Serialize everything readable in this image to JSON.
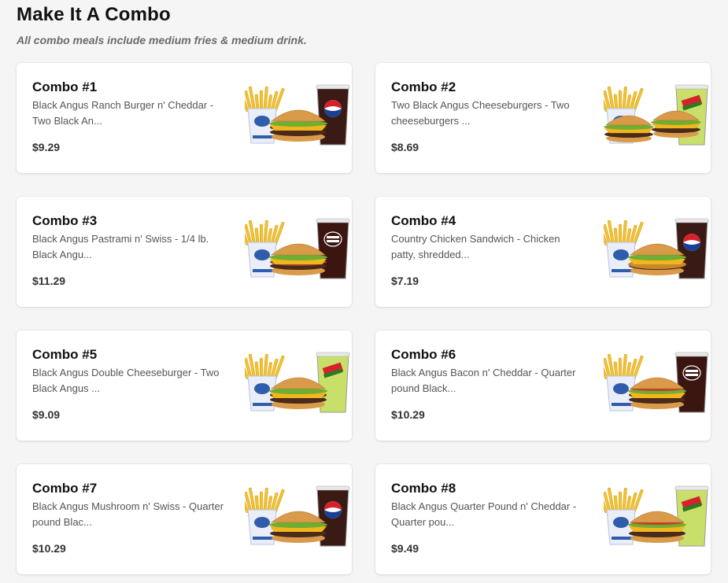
{
  "section": {
    "title": "Make It A Combo",
    "subtitle": "All combo meals include medium fries & medium drink."
  },
  "combos": [
    {
      "name": "Combo #1",
      "desc_line1": "Black Angus Ranch Burger n' Cheddar -",
      "desc_line2": "Two Black An...",
      "price": "$9.29",
      "drink": "pepsi",
      "burger": "double",
      "drink_logo": "PEPSI",
      "image_icon": "combo-meal-image"
    },
    {
      "name": "Combo #2",
      "desc_line1": "Two Black Angus Cheeseburgers - Two",
      "desc_line2": "cheeseburgers ...",
      "price": "$8.69",
      "drink": "mtndew",
      "burger": "two",
      "drink_logo": "Mtn Dew",
      "image_icon": "combo-meal-image"
    },
    {
      "name": "Combo #3",
      "desc_line1": "Black Angus Pastrami n' Swiss - 1/4 lb.",
      "desc_line2": "Black Angu...",
      "price": "$11.29",
      "drink": "drpepper",
      "burger": "pastrami",
      "drink_logo": "Dr Pepper",
      "image_icon": "combo-meal-image"
    },
    {
      "name": "Combo #4",
      "desc_line1": "Country Chicken Sandwich - Chicken",
      "desc_line2": "patty, shredded...",
      "price": "$7.19",
      "drink": "pepsi",
      "burger": "chicken",
      "drink_logo": "PEPSI",
      "image_icon": "combo-meal-image"
    },
    {
      "name": "Combo #5",
      "desc_line1": "Black Angus Double Cheeseburger - Two",
      "desc_line2": "Black Angus ...",
      "price": "$9.09",
      "drink": "mtndew",
      "burger": "double",
      "drink_logo": "Mtn Dew",
      "image_icon": "combo-meal-image"
    },
    {
      "name": "Combo #6",
      "desc_line1": "Black Angus Bacon n' Cheddar - Quarter",
      "desc_line2": "pound Black...",
      "price": "$10.29",
      "drink": "drpepper",
      "burger": "bacon",
      "drink_logo": "Dr Pepper",
      "image_icon": "combo-meal-image"
    },
    {
      "name": "Combo #7",
      "desc_line1": "Black Angus Mushroom n' Swiss - Quarter",
      "desc_line2": "pound Blac...",
      "price": "$10.29",
      "drink": "pepsi",
      "burger": "mushroom",
      "drink_logo": "PEPSI",
      "image_icon": "combo-meal-image"
    },
    {
      "name": "Combo #8",
      "desc_line1": "Black Angus Quarter Pound n' Cheddar -",
      "desc_line2": "Quarter pou...",
      "price": "$9.49",
      "drink": "mtndew",
      "burger": "cheddar",
      "drink_logo": "Mtn Dew",
      "image_icon": "combo-meal-image"
    }
  ],
  "colors": {
    "pepsi_cup": "#3a1a14",
    "drpepper_cup": "#3b1510",
    "mtndew_cup": "#c8e06a",
    "bun": "#d99a4a",
    "patty": "#4a2a18",
    "cheese": "#f2b51c",
    "lettuce": "#6fae32",
    "fries": "#f1c232",
    "fry_box": "#e9eef8"
  }
}
